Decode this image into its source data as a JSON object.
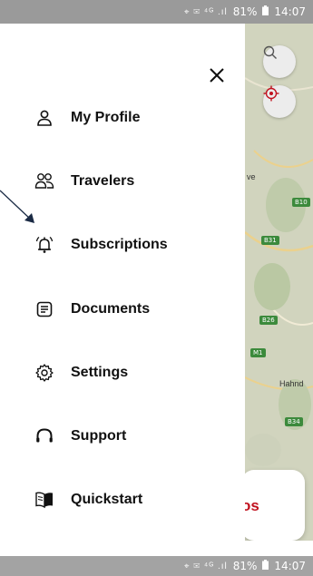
{
  "status_bar": {
    "icons": "⌖ ✉ ⁴ᴳ .ıl",
    "battery": "81%",
    "time": "14:07"
  },
  "map": {
    "place_labels": [
      "ve",
      "Hahnd"
    ],
    "road_badges": [
      "B10",
      "B31",
      "B26",
      "B34",
      "M1"
    ],
    "card_text": "os"
  },
  "drawer": {
    "menu": [
      {
        "id": "profile",
        "label": "My Profile",
        "icon": "person-icon"
      },
      {
        "id": "travelers",
        "label": "Travelers",
        "icon": "group-icon"
      },
      {
        "id": "subscriptions",
        "label": "Subscriptions",
        "icon": "bell-ringing-icon"
      },
      {
        "id": "documents",
        "label": "Documents",
        "icon": "document-icon"
      },
      {
        "id": "settings",
        "label": "Settings",
        "icon": "gear-icon"
      },
      {
        "id": "support",
        "label": "Support",
        "icon": "headset-icon"
      },
      {
        "id": "quickstart",
        "label": "Quickstart",
        "icon": "book-icon"
      }
    ]
  },
  "colors": {
    "map_background": "#c9cdb3",
    "card_accent": "#c1121f",
    "status_bar": "#9a9a9a"
  }
}
